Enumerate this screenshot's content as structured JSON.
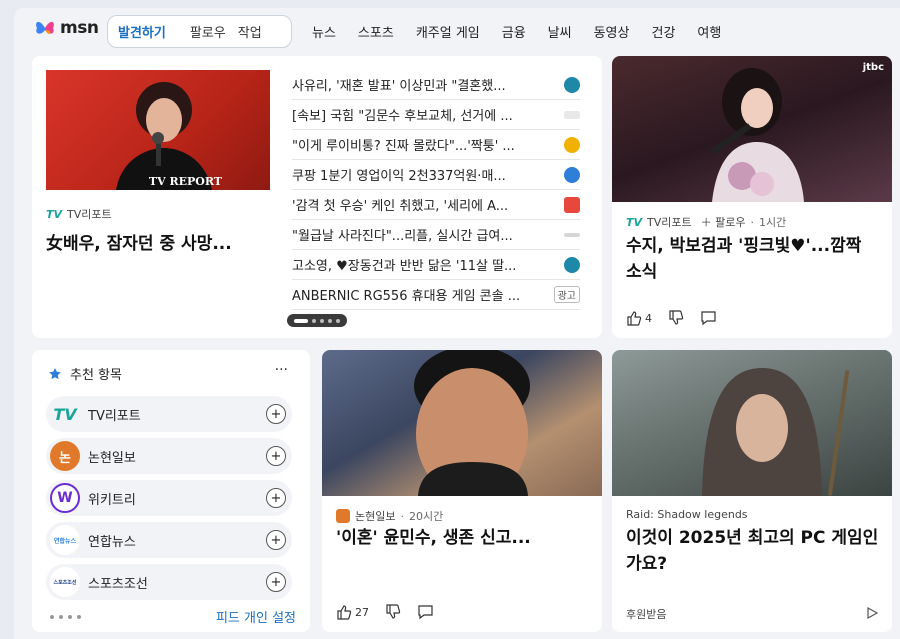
{
  "header": {
    "logo_text": "msn",
    "pill_tabs": [
      "발견하기",
      "팔로우",
      "작업"
    ],
    "nav": [
      "뉴스",
      "스포츠",
      "캐주얼 게임",
      "금융",
      "날씨",
      "동영상",
      "건강",
      "여행"
    ]
  },
  "featured": {
    "source": "TV리포트",
    "image_watermark": "TV REPORT",
    "headline": "女배우, 잠자던 중 사망...",
    "news": [
      {
        "title": "사유리, '재혼 발표' 이상민과 \"결혼했...",
        "pub_color": "#1e88a8"
      },
      {
        "title": "[속보] 국힘 \"김문수 후보교체, 선거에 ...",
        "pub_color": "#d0d0d0"
      },
      {
        "title": "\"이게 루이비통? 진짜 몰랐다\"...'짝퉁' ...",
        "pub_color": "#f2b100"
      },
      {
        "title": "쿠팡 1분기 영업이익 2천337억원·매...",
        "pub_color": "#2f7fd9"
      },
      {
        "title": "'감격 첫 우승' 케인 취했고, '세리에 A...",
        "pub_color": "#e8473c"
      },
      {
        "title": "\"월급날 사라진다\"...리플, 실시간 급여...",
        "pub_color": "#c8c8c8"
      },
      {
        "title": "고소영, ♥장동건과 반반 닮은 '11살 딸...",
        "pub_color": "#1e88a8"
      },
      {
        "title": "ANBERNIC RG556 휴대용 게임 콘솔 ...",
        "ad": "광고"
      }
    ]
  },
  "card2": {
    "source": "TV리포트",
    "follow": "팔로우",
    "time": "1시간",
    "headline": "수지, 박보검과 '핑크빛♥'...깜짝 소식",
    "likes": "4",
    "image_watermark": "jtbc"
  },
  "sidebar": {
    "title": "추천 항목",
    "items": [
      {
        "name": "TV리포트",
        "logo_text": "TV",
        "logo_color": "#1aa598"
      },
      {
        "name": "논현일보",
        "logo_text": "논",
        "logo_color": "#e07a2a"
      },
      {
        "name": "위키트리",
        "logo_text": "W",
        "logo_color": "#6a2bd1"
      },
      {
        "name": "연합뉴스",
        "logo_text": "연합뉴스",
        "logo_color": "#2f7fd9"
      },
      {
        "name": "스포츠조선",
        "logo_text": "스포츠조선",
        "logo_color": "#1c3f8a"
      }
    ],
    "feed_setting": "피드 개인 설정"
  },
  "card4": {
    "source": "논현일보",
    "time": "20시간",
    "headline": "'이혼' 윤민수, 생존 신고...",
    "likes": "27"
  },
  "card5": {
    "source": "Raid: Shadow legends",
    "headline": "이것이 2025년 최고의 PC 게임인가요?",
    "sponsored": "후원받음"
  }
}
